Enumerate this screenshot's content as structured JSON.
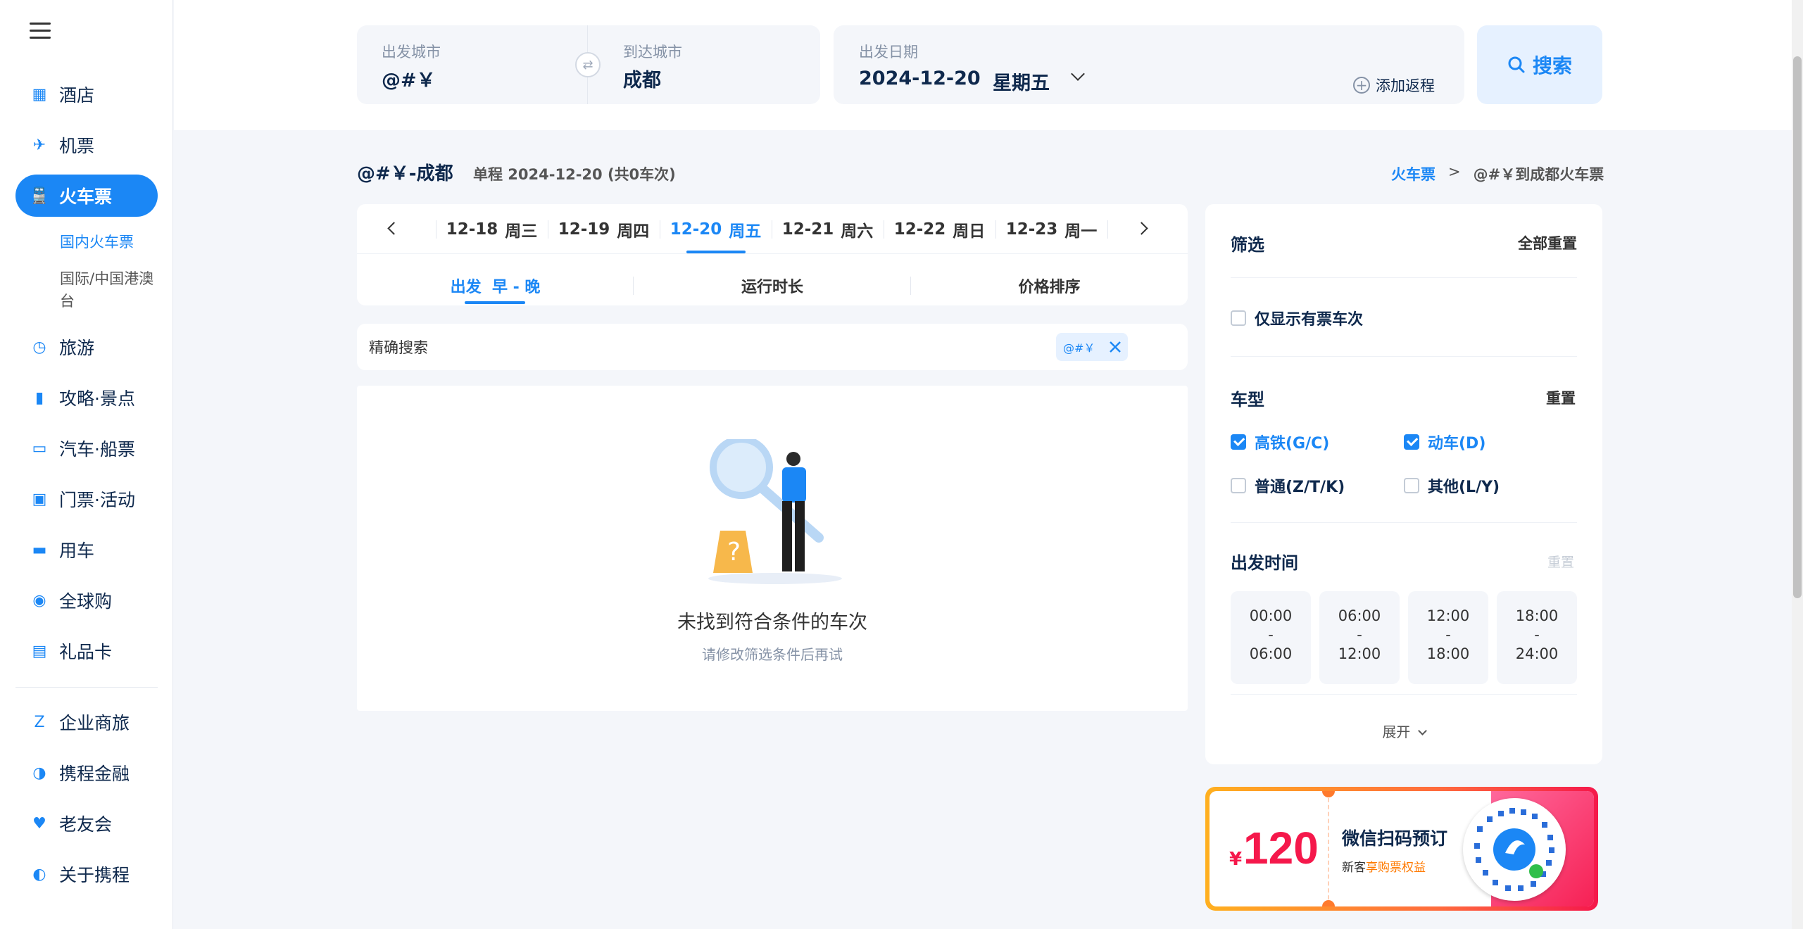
{
  "sidebar": {
    "items": [
      {
        "label": "酒店",
        "icon": "hotel-icon"
      },
      {
        "label": "机票",
        "icon": "airplane-icon"
      },
      {
        "label": "火车票",
        "icon": "train-icon"
      },
      {
        "label": "旅游",
        "icon": "travel-icon"
      },
      {
        "label": "攻略·景点",
        "icon": "guide-book-icon"
      },
      {
        "label": "汽车·船票",
        "icon": "bus-icon"
      },
      {
        "label": "门票·活动",
        "icon": "ticket-image-icon"
      },
      {
        "label": "用车",
        "icon": "car-icon"
      },
      {
        "label": "全球购",
        "icon": "globe-shopping-icon"
      },
      {
        "label": "礼品卡",
        "icon": "gift-card-icon"
      },
      {
        "label": "企业商旅",
        "icon": "business-z-icon"
      },
      {
        "label": "携程金融",
        "icon": "finance-dolphin-icon"
      },
      {
        "label": "老友会",
        "icon": "club-icon"
      },
      {
        "label": "关于携程",
        "icon": "about-dolphin-icon"
      }
    ],
    "sub": {
      "domestic": "国内火车票",
      "international": "国际/中国港澳台"
    }
  },
  "search": {
    "from_label": "出发城市",
    "from_value": "@#￥",
    "to_label": "到达城市",
    "to_value": "成都",
    "date_label": "出发日期",
    "date_value": "2024-12-20",
    "weekday": "星期五",
    "add_return": "添加返程",
    "button": "搜索"
  },
  "header": {
    "route": "@#￥-成都",
    "info": "单程 2024-12-20 (共0车次)",
    "crumb_link": "火车票",
    "crumb_sep": ">",
    "crumb_current": "@#￥到成都火车票"
  },
  "dates": [
    {
      "d": "12-18",
      "w": "周三"
    },
    {
      "d": "12-19",
      "w": "周四"
    },
    {
      "d": "12-20",
      "w": "周五"
    },
    {
      "d": "12-21",
      "w": "周六"
    },
    {
      "d": "12-22",
      "w": "周日"
    },
    {
      "d": "12-23",
      "w": "周一"
    }
  ],
  "sort": {
    "depart": "出发",
    "depart_sub": "早 - 晚",
    "duration": "运行时长",
    "price": "价格排序"
  },
  "precise": {
    "label": "精确搜索",
    "tag": "@#￥"
  },
  "empty": {
    "title": "未找到符合条件的车次",
    "sub": "请修改筛选条件后再试"
  },
  "filter": {
    "title": "筛选",
    "reset_all": "全部重置",
    "only_available": "仅显示有票车次",
    "type_title": "车型",
    "type_reset": "重置",
    "types": [
      {
        "label": "高铁(G/C)",
        "checked": true
      },
      {
        "label": "动车(D)",
        "checked": true
      },
      {
        "label": "普通(Z/T/K)",
        "checked": false
      },
      {
        "label": "其他(L/Y)",
        "checked": false
      }
    ],
    "time_title": "出发时间",
    "time_reset": "重置",
    "times": [
      [
        "00:00",
        "-",
        "06:00"
      ],
      [
        "06:00",
        "-",
        "12:00"
      ],
      [
        "12:00",
        "-",
        "18:00"
      ],
      [
        "18:00",
        "-",
        "24:00"
      ]
    ],
    "expand": "展开"
  },
  "promo": {
    "currency": "¥",
    "amount": "120",
    "title": "微信扫码预订",
    "sub_prefix": "新客",
    "sub_highlight": "享购票权益"
  },
  "colors": {
    "brand": "#1b87f5",
    "promo_red": "#f5184b",
    "promo_orange": "#ff9a1f"
  }
}
